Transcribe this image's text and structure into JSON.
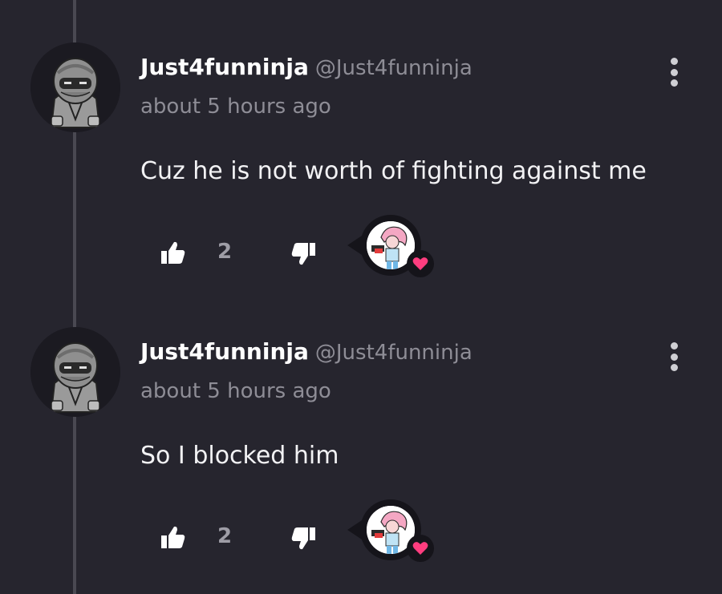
{
  "comments": [
    {
      "username": "Just4funninja",
      "handle": "@Just4funninja",
      "timestamp": "about 5 hours ago",
      "text": "Cuz he is not worth of fighting against me",
      "likes": "2",
      "reaction": "heart"
    },
    {
      "username": "Just4funninja",
      "handle": "@Just4funninja",
      "timestamp": "about 5 hours ago",
      "text": "So I blocked him",
      "likes": "2",
      "reaction": "heart"
    }
  ],
  "colors": {
    "background": "#26252e",
    "heart": "#ff3d7f",
    "muted_text": "#8e8d96"
  },
  "icons": {
    "like": "thumbs-up-icon",
    "dislike": "thumbs-down-icon",
    "more": "more-vertical-icon",
    "reaction": "heart-icon"
  }
}
